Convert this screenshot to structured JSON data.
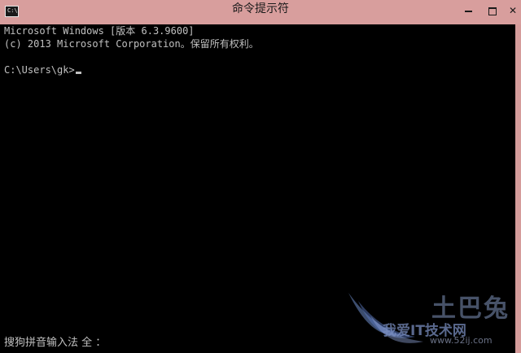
{
  "window": {
    "title": "命令提示符",
    "icon_label": "C:\\."
  },
  "controls": {
    "minimize_icon": "minimize-icon",
    "maximize_icon": "maximize-icon",
    "close_label": "✕"
  },
  "console": {
    "lines": [
      "Microsoft Windows [版本 6.3.9600]",
      "(c) 2013 Microsoft Corporation。保留所有权利。",
      "",
      "C:\\Users\\gk>"
    ],
    "ime_status": "搜狗拼音输入法 全 ："
  },
  "watermark": {
    "logo_text": "土巴兔",
    "slogan": "我爱IT技术网",
    "url": "www.52ij.com"
  },
  "colors": {
    "titlebar": "#d89e9d",
    "console_bg": "#000000",
    "console_text": "#c0c0c0"
  }
}
